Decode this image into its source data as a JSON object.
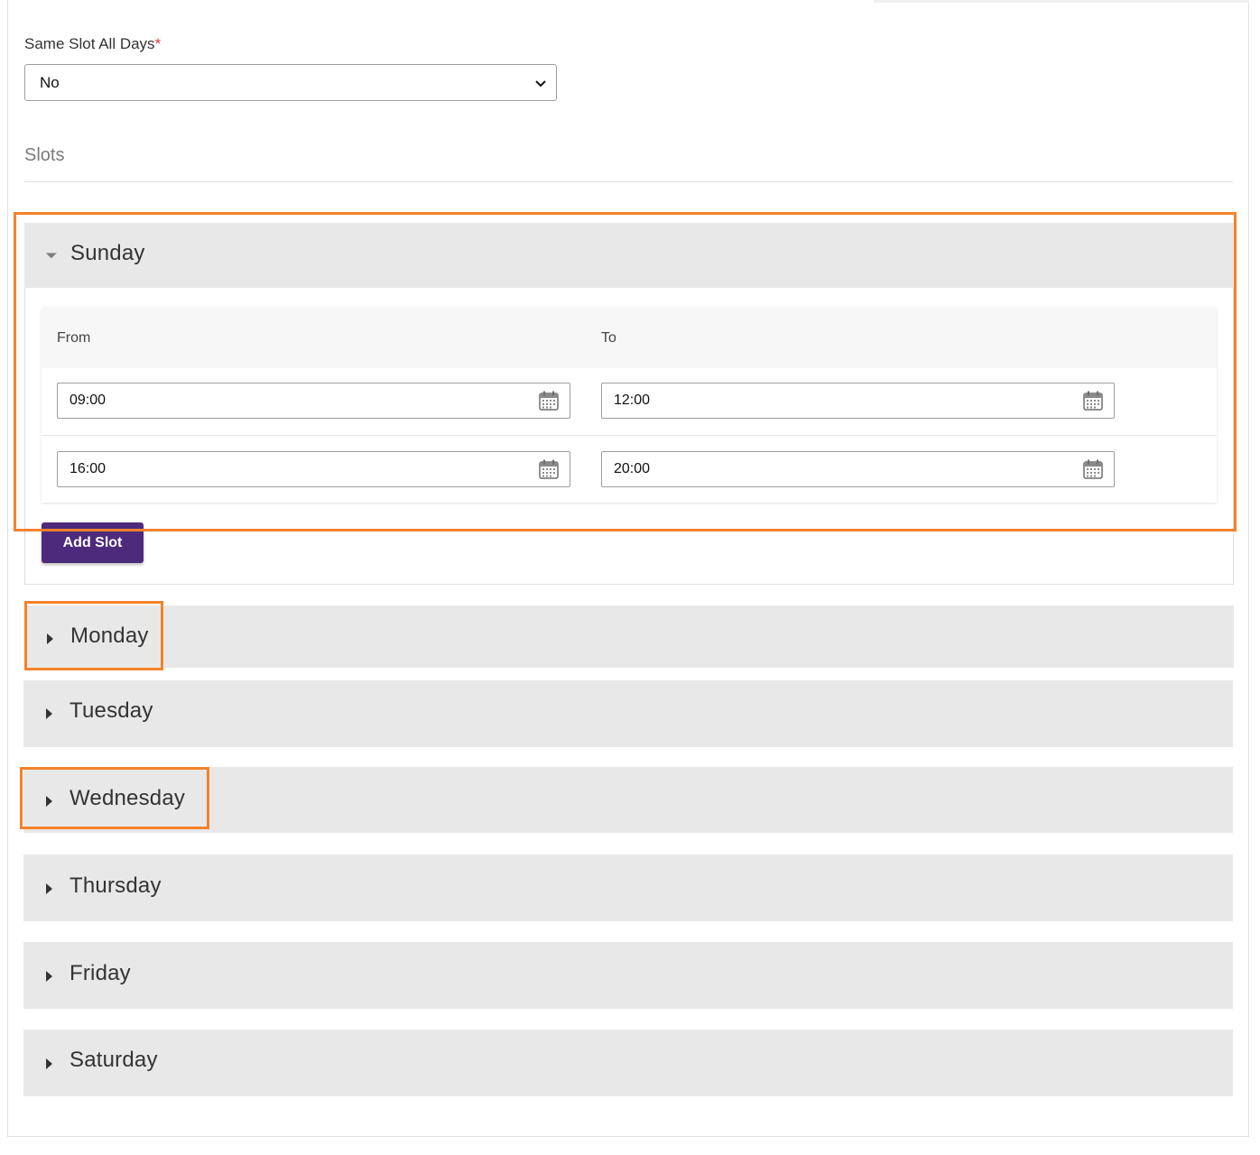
{
  "form": {
    "same_slot_label": "Same Slot All Days",
    "required_mark": "*",
    "same_slot_value": "No"
  },
  "slots": {
    "title": "Slots",
    "columns": {
      "from": "From",
      "to": "To"
    },
    "add_slot_label": "Add Slot"
  },
  "days": [
    {
      "name": "Sunday",
      "expanded": true,
      "rows": [
        {
          "from": "09:00",
          "to": "12:00"
        },
        {
          "from": "16:00",
          "to": "20:00"
        }
      ]
    },
    {
      "name": "Monday",
      "expanded": false
    },
    {
      "name": "Tuesday",
      "expanded": false
    },
    {
      "name": "Wednesday",
      "expanded": false
    },
    {
      "name": "Thursday",
      "expanded": false
    },
    {
      "name": "Friday",
      "expanded": false
    },
    {
      "name": "Saturday",
      "expanded": false
    }
  ],
  "colors": {
    "accent_button": "#4e2a7d",
    "highlight": "#f5822a",
    "header_bg": "#e8e8e8",
    "required": "#e53935"
  },
  "icons": {
    "select_chevron": "chevron-down-icon",
    "expanded_day": "caret-down-icon",
    "collapsed_day": "caret-right-icon",
    "time_picker": "calendar-icon"
  }
}
